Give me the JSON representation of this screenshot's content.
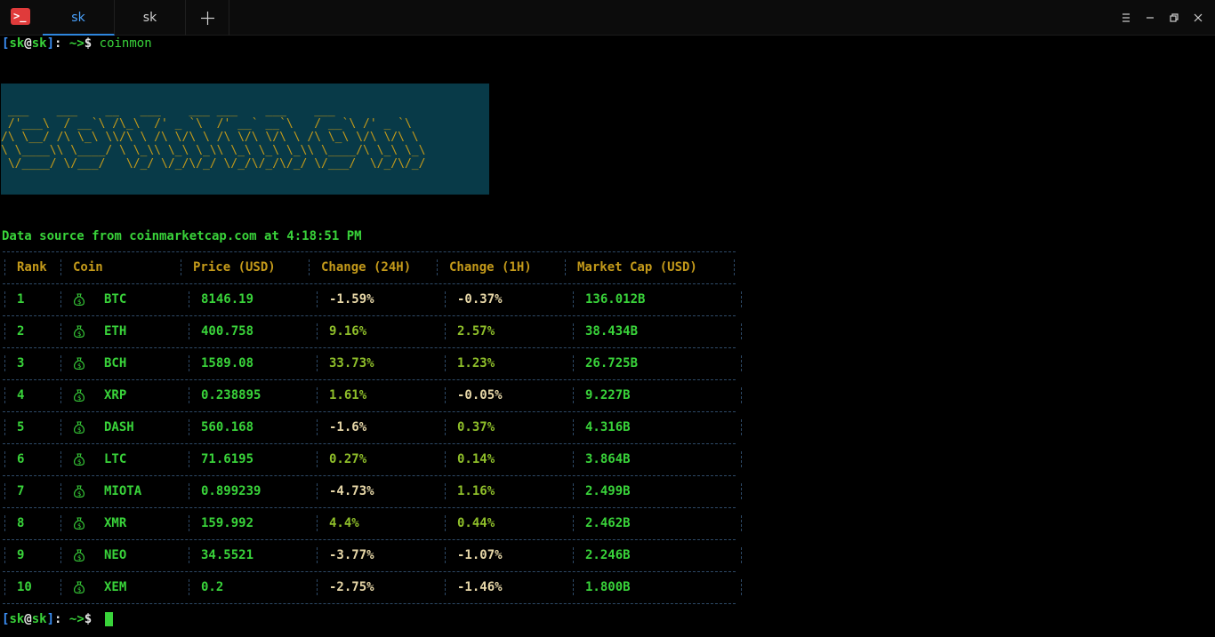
{
  "window": {
    "tabs": [
      {
        "label": "sk",
        "active": true
      },
      {
        "label": "sk",
        "active": false
      }
    ],
    "icons": [
      "terminal-app-icon",
      "new-tab-icon",
      "menu-icon",
      "minimize-icon",
      "restore-icon",
      "close-icon"
    ]
  },
  "terminal": {
    "prompt": {
      "open": "[",
      "user": "sk",
      "at": "@",
      "host": "sk",
      "close": "]",
      "sep": ":",
      "path": " ~>",
      "dollar": "$"
    },
    "command": "coinmon",
    "banner_art": " ___    ___    __   ___    ___ ___    ___    ___\n /'___\\  / __`\\ /\\_\\  /' _ `\\  /' __` __`\\   / __`\\ /' _ `\\\n/\\ \\__/ /\\ \\_\\ \\\\/\\ \\ /\\ \\/\\ \\ /\\ \\/\\ \\/\\ \\ /\\ \\_\\ \\/\\ \\/\\ \\\n\\ \\____\\\\ \\____/ \\ \\_\\\\ \\_\\ \\_\\\\ \\_\\ \\_\\ \\_\\\\ \\____/\\ \\_\\ \\_\\\n \\/____/ \\/___/   \\/_/ \\/_/\\/_/ \\/_/\\/_/\\/_/ \\/___/  \\/_/\\/_/",
    "source_line": "Data source from coinmarketcap.com at 4:18:51 PM",
    "table": {
      "headers": [
        "Rank",
        "Coin",
        "Price (USD)",
        "Change (24H)",
        "Change (1H)",
        "Market Cap (USD)"
      ],
      "rows": [
        {
          "rank": "1",
          "coin": "BTC",
          "price": "8146.19",
          "change24h": "-1.59%",
          "change1h": "-0.37%",
          "market_cap": "136.012B"
        },
        {
          "rank": "2",
          "coin": "ETH",
          "price": "400.758",
          "change24h": "9.16%",
          "change1h": "2.57%",
          "market_cap": "38.434B"
        },
        {
          "rank": "3",
          "coin": "BCH",
          "price": "1589.08",
          "change24h": "33.73%",
          "change1h": "1.23%",
          "market_cap": "26.725B"
        },
        {
          "rank": "4",
          "coin": "XRP",
          "price": "0.238895",
          "change24h": "1.61%",
          "change1h": "-0.05%",
          "market_cap": "9.227B"
        },
        {
          "rank": "5",
          "coin": "DASH",
          "price": "560.168",
          "change24h": "-1.6%",
          "change1h": "0.37%",
          "market_cap": "4.316B"
        },
        {
          "rank": "6",
          "coin": "LTC",
          "price": "71.6195",
          "change24h": "0.27%",
          "change1h": "0.14%",
          "market_cap": "3.864B"
        },
        {
          "rank": "7",
          "coin": "MIOTA",
          "price": "0.899239",
          "change24h": "-4.73%",
          "change1h": "1.16%",
          "market_cap": "2.499B"
        },
        {
          "rank": "8",
          "coin": "XMR",
          "price": "159.992",
          "change24h": "4.4%",
          "change1h": "0.44%",
          "market_cap": "2.462B"
        },
        {
          "rank": "9",
          "coin": "NEO",
          "price": "34.5521",
          "change24h": "-3.77%",
          "change1h": "-1.07%",
          "market_cap": "2.246B"
        },
        {
          "rank": "10",
          "coin": "XEM",
          "price": "0.2",
          "change24h": "-2.75%",
          "change1h": "-1.46%",
          "market_cap": "1.800B"
        }
      ]
    }
  },
  "colors": {
    "prompt_blue": "#3b8ff5",
    "green": "#39d33a",
    "gold": "#c49a1a",
    "banner_bg": "#083a48",
    "tab_accent": "#2e86de"
  }
}
